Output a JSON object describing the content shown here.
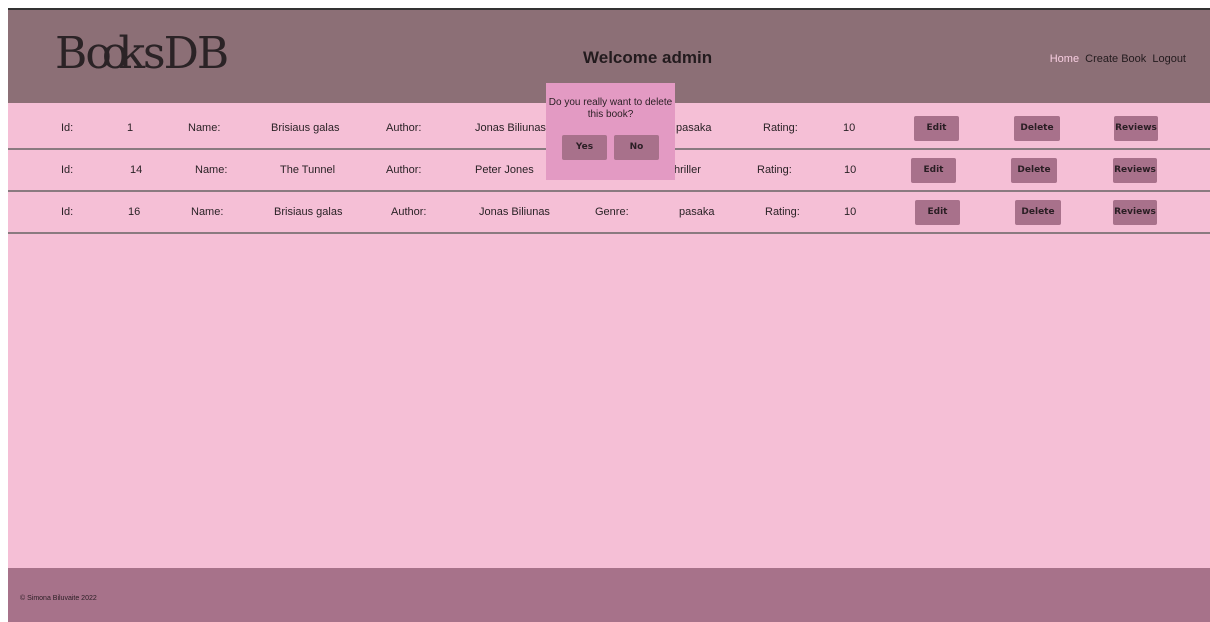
{
  "header": {
    "logo": {
      "part1": "B",
      "part2": "oo",
      "part3": "ksDB"
    },
    "welcome": "Welcome admin",
    "nav": [
      "Home",
      "Create Book",
      "Logout"
    ]
  },
  "labels": {
    "id": "Id:",
    "name": "Name:",
    "author": "Author:",
    "genre": "Genre:",
    "rating": "Rating:",
    "edit": "Edit",
    "delete": "Delete",
    "reviews": "Reviews"
  },
  "books": [
    {
      "id": "1",
      "name": "Brisiaus galas",
      "author": "Jonas Biliunas",
      "genre": "pasaka",
      "rating": "10"
    },
    {
      "id": "14",
      "name": "The Tunnel",
      "author": "Peter Jones",
      "genre": "hriller",
      "rating": "10"
    },
    {
      "id": "16",
      "name": "Brisiaus galas",
      "author": "Jonas Biliunas",
      "genre": "pasaka",
      "rating": "10"
    }
  ],
  "modal": {
    "message": "Do you really want to delete this book?",
    "yes": "Yes",
    "no": "No"
  },
  "footer": {
    "copyright": "© Simona Biluvaite 2022"
  }
}
